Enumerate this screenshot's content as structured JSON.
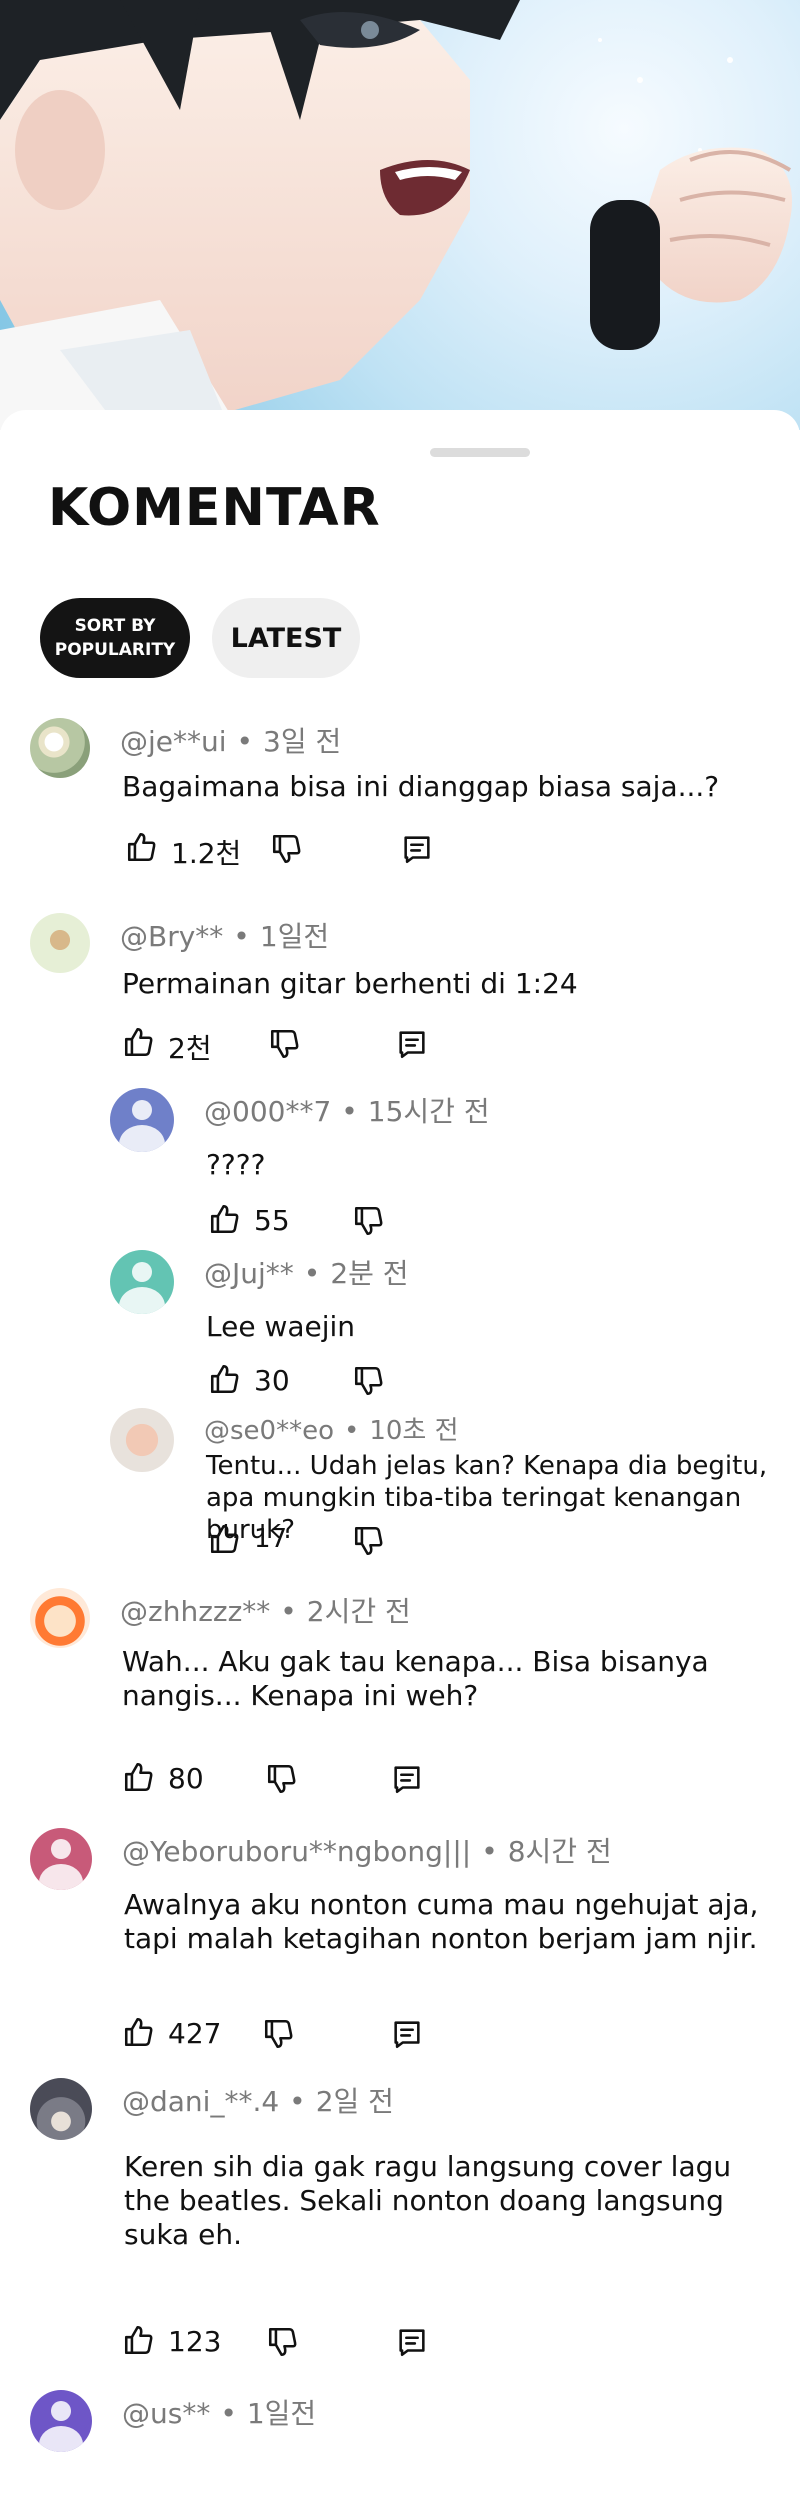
{
  "header": {
    "title": "KOMENTAR",
    "sort_options": [
      {
        "label": "SORT BY\nPOPULARITY",
        "selected": true
      },
      {
        "label": "LATEST",
        "selected": false
      }
    ]
  },
  "colors": {
    "chip_active": "#141414",
    "chip_inactive": "#efefef",
    "meta_text": "#7a7a7a"
  },
  "comments": [
    {
      "user": "@je**ui",
      "time": "3일 전",
      "text": "Bagaimana bisa ini dianggap biasa saja...?",
      "likes": "1.2천"
    },
    {
      "user": "@Bry**",
      "time": "1일전",
      "text": "Permainan gitar berhenti di 1:24",
      "likes": "2천"
    },
    {
      "user": "@000**7",
      "time": "15시간 전",
      "text": "????",
      "likes": "55"
    },
    {
      "user": "@Juj**",
      "time": "2분 전",
      "text": "Lee waejin",
      "likes": "30"
    },
    {
      "user": "@se0**eo",
      "time": "10초 전",
      "text": "Tentu... Udah jelas kan? Kenapa dia begitu,\napa mungkin tiba-tiba teringat kenangan buruk?",
      "likes": "17"
    },
    {
      "user": "@zhhzzz**",
      "time": "2시간 전",
      "text": "Wah... Aku gak tau kenapa... Bisa bisanya\nnangis... Kenapa ini weh?",
      "likes": "80"
    },
    {
      "user": "@Yeboruboru**ngbong|||",
      "time": "8시간 전",
      "text": "Awalnya aku nonton cuma mau ngehujat aja,\ntapi malah ketagihan nonton berjam jam njir.",
      "likes": "427"
    },
    {
      "user": "@dani_**.4",
      "time": "2일 전",
      "text": "Keren sih dia gak ragu langsung cover lagu\nthe beatles. Sekali nonton doang langsung\nsuka eh.",
      "likes": "123"
    },
    {
      "user": "@us**",
      "time": "1일전",
      "text": "",
      "likes": ""
    }
  ],
  "icons": {
    "like": "thumbs-up-icon",
    "dislike": "thumbs-down-icon",
    "reply": "reply-icon",
    "avatar": "avatar-icon"
  }
}
